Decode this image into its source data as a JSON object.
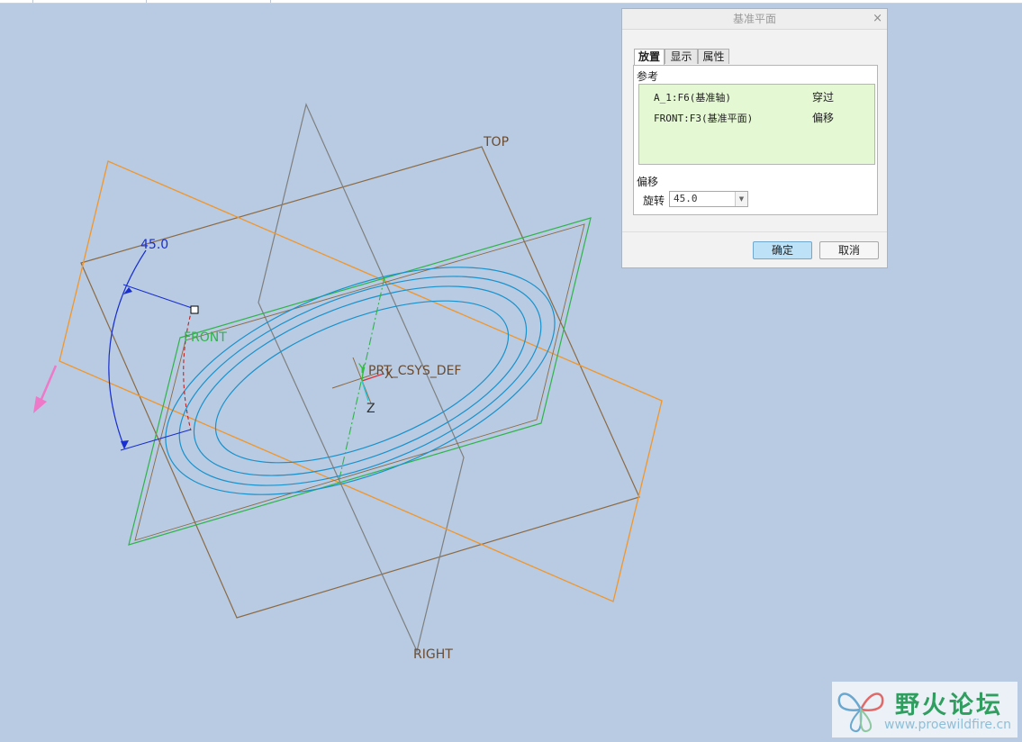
{
  "viewport": {
    "labels": {
      "top": "TOP",
      "front": "FRONT",
      "right": "RIGHT",
      "csys": "PRT_CSYS_DEF",
      "axis_x": "X",
      "axis_y": "Y",
      "axis_z": "Z",
      "dimension": "45.0"
    },
    "colors": {
      "background": "#b8cbe2",
      "top_plane": "#8b6a45",
      "right_plane": "#7f7f7f",
      "new_plane": "#f0962c",
      "front_plane": "#2fb34a",
      "ellipse": "#1a92cc",
      "dimension": "#1a2fcf",
      "arrow": "#ee79c8"
    }
  },
  "dialog": {
    "title": "基准平面",
    "close_glyph": "×",
    "tabs": [
      {
        "label": "放置",
        "active": true
      },
      {
        "label": "显示",
        "active": false
      },
      {
        "label": "属性",
        "active": false
      }
    ],
    "references_label": "参考",
    "references": [
      {
        "name": "A_1:F6(基准轴)",
        "constraint": "穿过"
      },
      {
        "name": "FRONT:F3(基准平面)",
        "constraint": "偏移"
      }
    ],
    "offset_label": "偏移",
    "rotation_label": "旋转",
    "rotation_value": "45.0",
    "ok_label": "确定",
    "cancel_label": "取消"
  },
  "watermark": {
    "title": "野火论坛",
    "url": "www.proewildfire.cn"
  }
}
